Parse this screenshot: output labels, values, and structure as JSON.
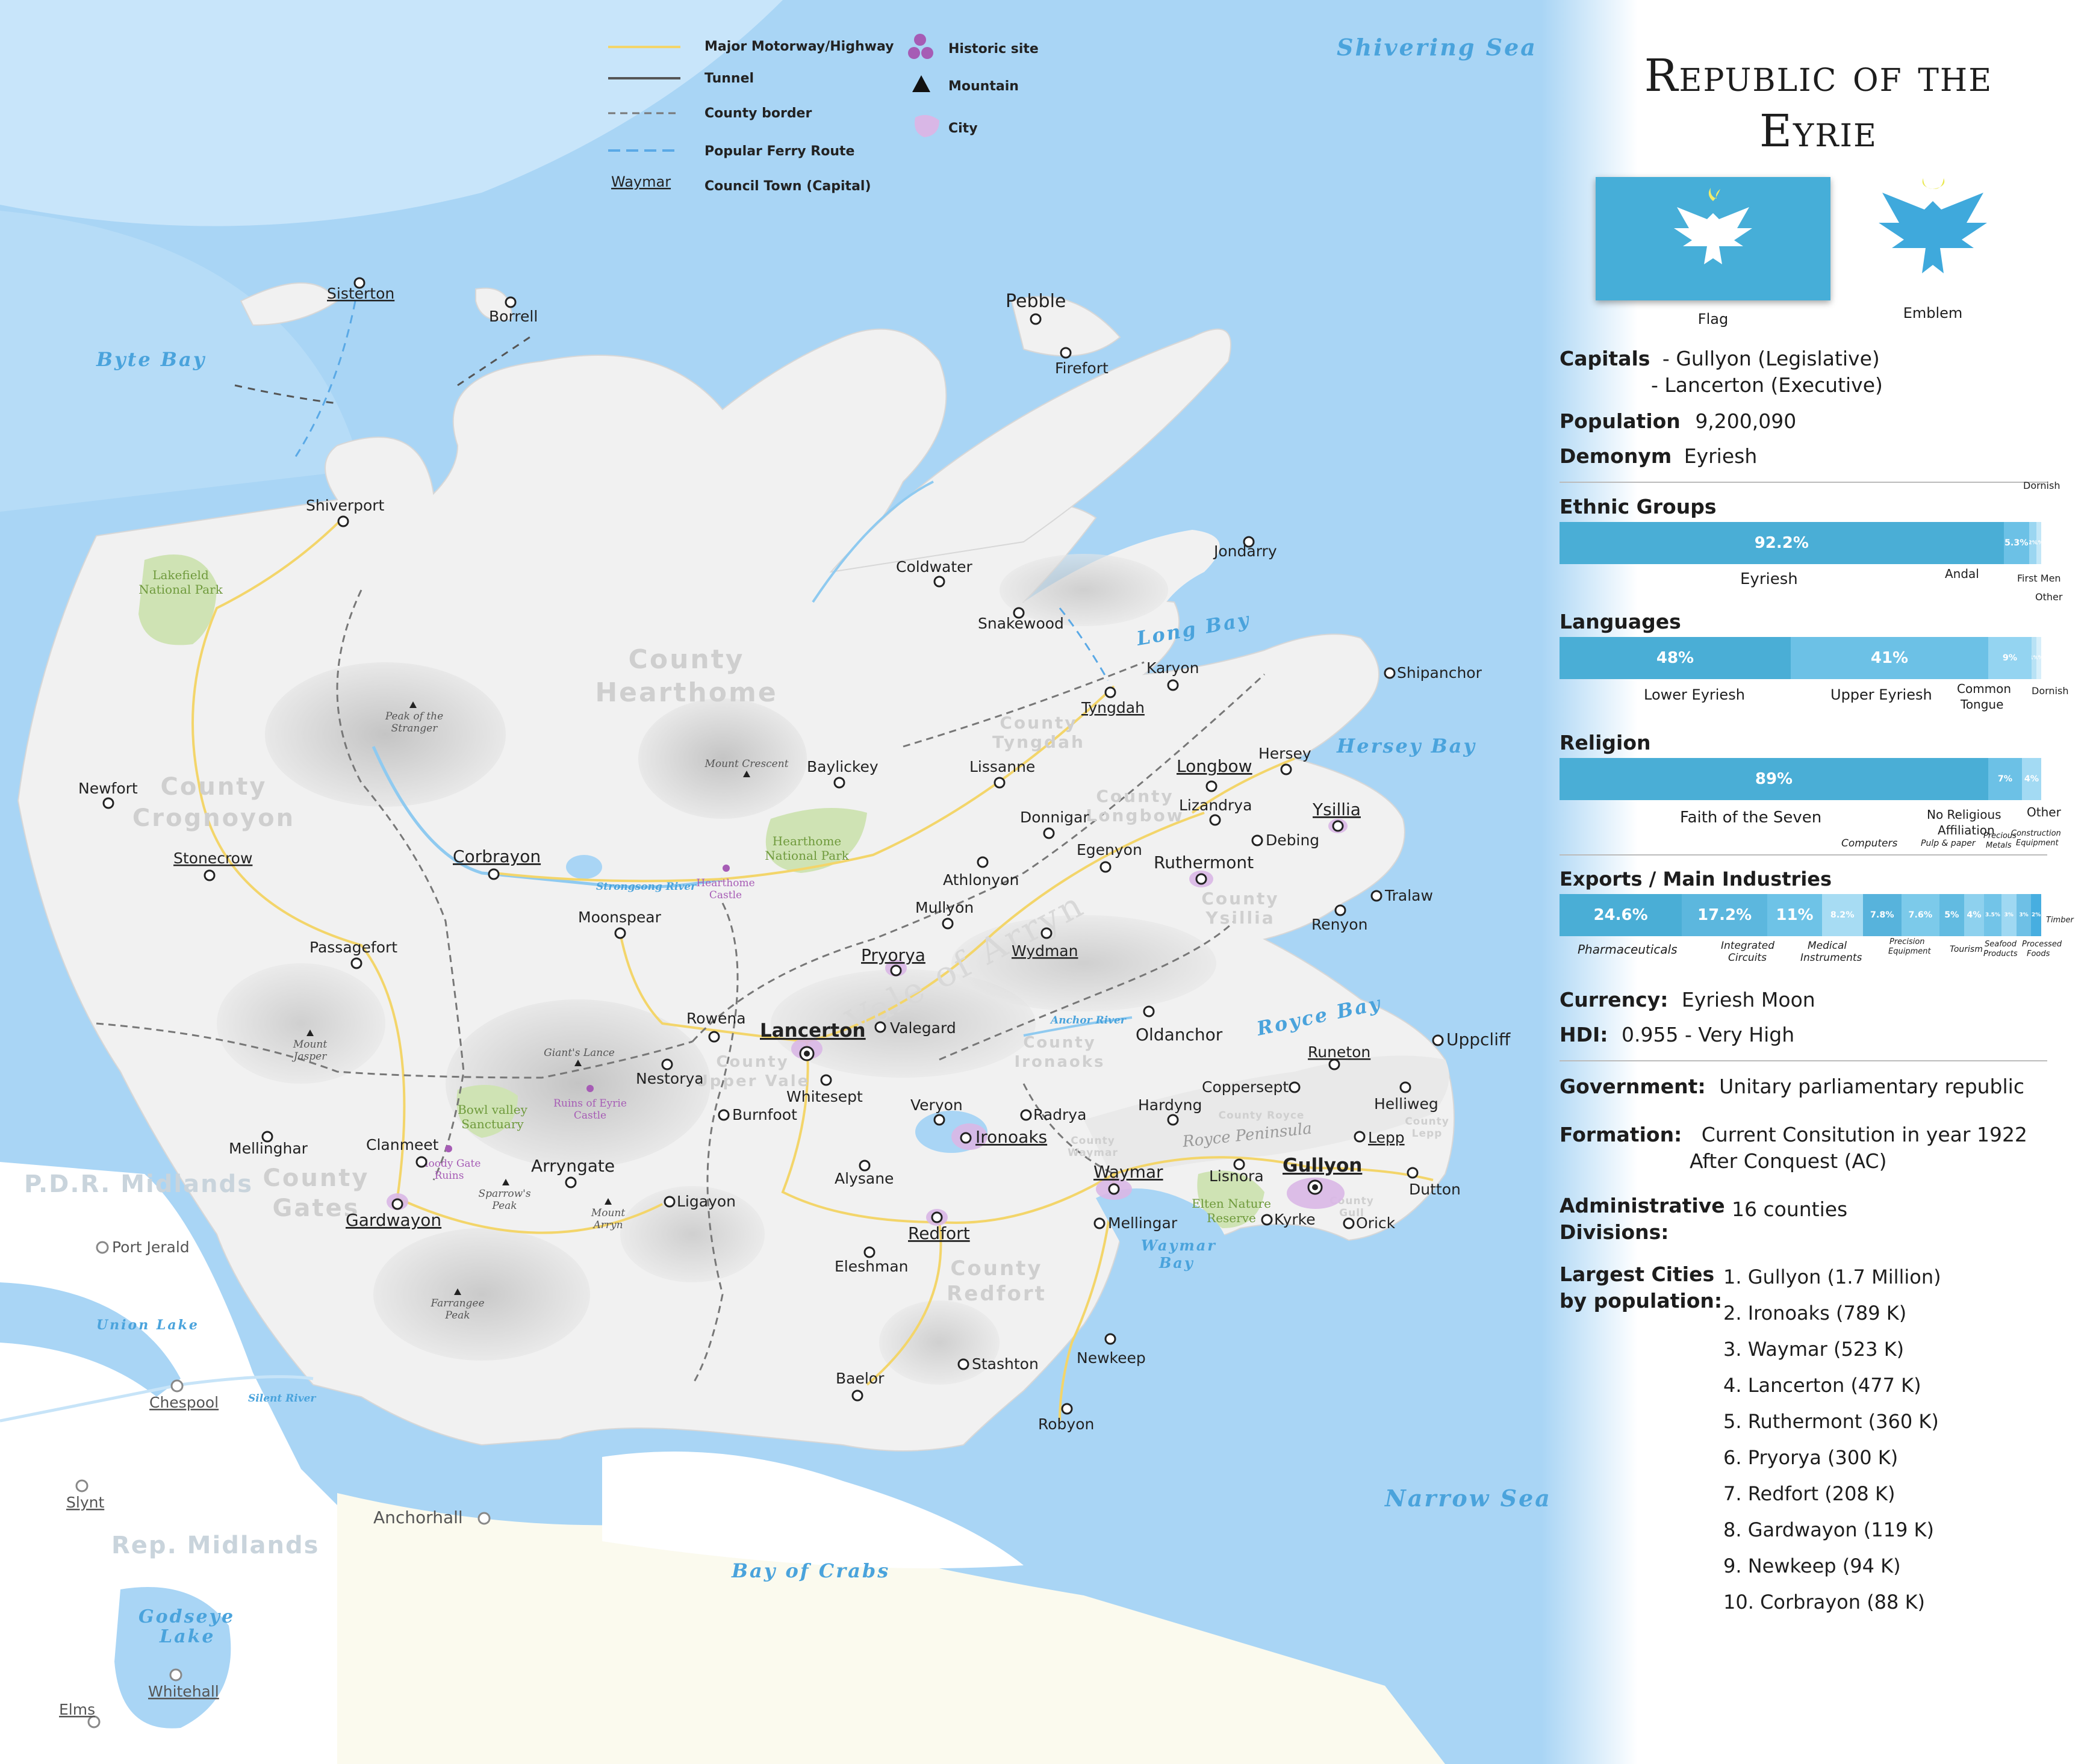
{
  "legend": {
    "highway": "Major Motorway/Highway",
    "tunnel": "Tunnel",
    "county_border": "County border",
    "ferry": "Popular Ferry Route",
    "capital_sample": "Waymar",
    "capital_desc": "Council Town (Capital)",
    "historic": "Historic site",
    "mountain": "Mountain",
    "city": "City"
  },
  "seas": {
    "shivering": "Shivering Sea",
    "byte": "Byte Bay",
    "long": "Long Bay",
    "hersey": "Hersey Bay",
    "royce": "Royce Bay",
    "narrow": "Narrow Sea",
    "crabs": "Bay of Crabs",
    "waymar_bay_1": "Waymar",
    "waymar_bay_2": "Bay",
    "union_lake": "Union Lake",
    "godseye_1": "Godseye",
    "godseye_2": "Lake",
    "strongsong": "Strongsong River",
    "silent": "Silent River",
    "anchor": "Anchor River"
  },
  "regions": {
    "pdr": "P.D.R. Midlands",
    "rep": "Rep. Midlands"
  },
  "counties": [
    {
      "l1": "County",
      "l2": "Hearthome"
    },
    {
      "l1": "County",
      "l2": "Crognoyon"
    },
    {
      "l1": "County",
      "l2": "Gates"
    },
    {
      "l1": "County",
      "l2": "Tyngdah"
    },
    {
      "l1": "County",
      "l2": "Longbow"
    },
    {
      "l1": "County",
      "l2": "Ysillia"
    },
    {
      "l1": "County",
      "l2": "Ironaoks"
    },
    {
      "l1": "County",
      "l2": "Upper Vale"
    },
    {
      "l1": "County",
      "l2": "Redfort"
    },
    {
      "l1": "County",
      "l2": "Waymar"
    },
    {
      "l1": "County Royce",
      "l2": ""
    },
    {
      "l1": "County",
      "l2": "Lepp"
    },
    {
      "l1": "County",
      "l2": "Gull"
    }
  ],
  "vale": "Vale of Arryn",
  "royce_peninsula": "Royce Peninsula",
  "parks": {
    "lakefield_1": "Lakefield",
    "lakefield_2": "National Park",
    "hearthome_1": "Hearthome",
    "hearthome_2": "National Park",
    "bowl_1": "Bowl valley",
    "bowl_2": "Sanctuary",
    "elten_1": "Elten Nature",
    "elten_2": "Reserve"
  },
  "historic_sites": {
    "hearthome_castle_1": "Hearthome",
    "hearthome_castle_2": "Castle",
    "eyrie_1": "Ruins of Eyrie",
    "eyrie_2": "Castle",
    "gate_1": "Bloody Gate",
    "gate_2": "Ruins"
  },
  "mountains": {
    "stranger_1": "Peak of the",
    "stranger_2": "Stranger",
    "crescent": "Mount Crescent",
    "jasper_1": "Mount",
    "jasper_2": "Jasper",
    "giants": "Giant's Lance",
    "sparrow_1": "Sparrow's",
    "sparrow_2": "Peak",
    "arryn_1": "Mount",
    "arryn_2": "Arryn",
    "farrangee_1": "Farrangee",
    "farrangee_2": "Peak"
  },
  "places": {
    "sisterton": "Sisterton",
    "borrell": "Borrell",
    "pebble": "Pebble",
    "firefort": "Firefort",
    "shiverport": "Shiverport",
    "coldwater": "Coldwater",
    "jondarry": "Jondarry",
    "snakewood": "Snakewood",
    "karyon": "Karyon",
    "shipanchor": "Shipanchor",
    "tyngdah": "Tyngdah",
    "newfort": "Newfort",
    "baylickey": "Baylickey",
    "lissanne": "Lissanne",
    "longbow": "Longbow",
    "hersey": "Hersey",
    "ysillia": "Ysillia",
    "stonecrow": "Stonecrow",
    "corbrayon": "Corbrayon",
    "donnigar": "Donnigar",
    "lizandrya": "Lizandrya",
    "debing": "Debing",
    "egenyon": "Egenyon",
    "ruthermont": "Ruthermont",
    "athlonyon": "Athlonyon",
    "tralaw": "Tralaw",
    "moonspear": "Moonspear",
    "mullyon": "Mullyon",
    "renyon": "Renyon",
    "passagefort": "Passagefort",
    "pryorya": "Pryorya",
    "wydman": "Wydman",
    "rowena": "Rowena",
    "lancerton": "Lancerton",
    "valegard": "Valegard",
    "oldanchor": "Oldanchor",
    "uppcliff": "Uppcliff",
    "nestorya": "Nestorya",
    "whitesept": "Whitesept",
    "runeton": "Runeton",
    "coppersept": "Coppersept",
    "helliweg": "Helliweg",
    "burnfoot": "Burnfoot",
    "veryon": "Veryon",
    "radrya": "Radrya",
    "hardyng": "Hardyng",
    "mellinghar": "Mellinghar",
    "clanmeet": "Clanmeet",
    "ironoaks": "Ironoaks",
    "lepp": "Lepp",
    "arryngate": "Arryngate",
    "alysane": "Alysane",
    "waymar": "Waymar",
    "lisnora": "Lisnora",
    "gullyon": "Gullyon",
    "dutton": "Dutton",
    "ligayon": "Ligayon",
    "gardwayon": "Gardwayon",
    "mellingar": "Mellingar",
    "kyrke": "Kyrke",
    "orick": "Orick",
    "redfort": "Redfort",
    "port_jerald": "Port Jerald",
    "eleshman": "Eleshman",
    "chespool": "Chespool",
    "stashton": "Stashton",
    "newkeep": "Newkeep",
    "baelor": "Baelor",
    "robyon": "Robyon",
    "slynt": "Slynt",
    "anchorhall": "Anchorhall",
    "whitehall": "Whitehall",
    "elms": "Elms"
  },
  "panel": {
    "title_1": "Republic of the",
    "title_2": "Eyrie",
    "flag_caption": "Flag",
    "emblem_caption": "Emblem",
    "capitals_label": "Capitals",
    "capital_1": "- Gullyon (Legislative)",
    "capital_2": "- Lancerton (Executive)",
    "population_label": "Population",
    "population": "9,200,090",
    "demonym_label": "Demonym",
    "demonym": "Eyriesh",
    "ethnic_title": "Ethnic Groups",
    "languages_title": "Languages",
    "religion_title": "Religion",
    "exports_title": "Exports / Main Industries",
    "currency_label": "Currency:",
    "currency": "Eyriesh Moon",
    "hdi_label": "HDI:",
    "hdi": "0.955 - Very High",
    "government_label": "Government:",
    "government": "Unitary parliamentary republic",
    "formation_label": "Formation:",
    "formation_1": "Current Consitution in year 1922",
    "formation_2": "After Conquest (AC)",
    "admin_label_1": "Administrative",
    "admin_label_2": "Divisions:",
    "admin": "16 counties",
    "largest_label_1": "Largest Cities",
    "largest_label_2": "by population:",
    "largest": [
      "1. Gullyon (1.7 Million)",
      "2. Ironoaks (789 K)",
      "3. Waymar (523 K)",
      "4. Lancerton (477 K)",
      "5. Ruthermont (360 K)",
      "6. Pryorya (300 K)",
      "7. Redfort (208 K)",
      "8. Gardwayon (119 K)",
      "9. Newkeep (94 K)",
      "10. Corbrayon (88 K)"
    ]
  },
  "ethnic": [
    {
      "name": "Eyriesh",
      "value": 92.2,
      "label": "92.2%",
      "color": "#4aaed6"
    },
    {
      "name": "Andal",
      "value": 5.3,
      "label": "5.3%",
      "color": "#6cc1e6"
    },
    {
      "name": "Dornish",
      "value": 1.5,
      "label": "2%",
      "color": "#9bd6f1"
    },
    {
      "name": "First Men",
      "value": 1.0,
      "label": "1%",
      "color": "#c3e7f7"
    }
  ],
  "languages": [
    {
      "name": "Lower Eyriesh",
      "value": 48,
      "label": "48%",
      "color": "#4aaed6"
    },
    {
      "name": "Upper Eyriesh",
      "value": 41,
      "label": "41%",
      "color": "#6cc1e6"
    },
    {
      "name_1": "Common",
      "name_2": "Tongue",
      "value": 9,
      "label": "9%",
      "color": "#94d4f1"
    },
    {
      "name": "Other",
      "value": 1,
      "label": "1%",
      "color": "#b8e2f5"
    },
    {
      "name": "Dornish",
      "value": 1,
      "label": "1%",
      "color": "#d7effa"
    }
  ],
  "religion": [
    {
      "name": "Faith of the Seven",
      "value": 89,
      "label": "89%",
      "color": "#4aaed6"
    },
    {
      "name_1": "No Religious",
      "name_2": "Affiliation",
      "value": 7,
      "label": "7%",
      "color": "#6cc1e6"
    },
    {
      "name": "Other",
      "value": 4,
      "label": "4%",
      "color": "#a3daf3"
    }
  ],
  "exports": [
    {
      "name": "Pharmaceuticals",
      "value": 24.6,
      "label": "24.6%",
      "color": "#4aaed6"
    },
    {
      "name_1": "Integrated",
      "name_2": "Circuits",
      "value": 17.2,
      "label": "17.2%",
      "color": "#5cb7de"
    },
    {
      "name_1": "Medical",
      "name_2": "Instruments",
      "value": 11,
      "label": "11%",
      "color": "#6ec3e7"
    },
    {
      "name": "Computers",
      "value": 8.2,
      "label": "8.2%",
      "color": "#a7dcf3"
    },
    {
      "name_1": "Precision",
      "name_2": "Equipment",
      "value": 7.8,
      "label": "7.8%",
      "color": "#57b3dc"
    },
    {
      "name": "Pulp & paper",
      "value": 7.6,
      "label": "7.6%",
      "color": "#7ccaea"
    },
    {
      "name": "Tourism",
      "value": 5,
      "label": "5%",
      "color": "#62bbe1"
    },
    {
      "name_1": "Precious",
      "name_2": "Metals",
      "value": 4,
      "label": "4%",
      "color": "#8ed1ee"
    },
    {
      "name_1": "Seafood",
      "name_2": "Products",
      "value": 3.5,
      "label": "3.5%",
      "color": "#72c4e8"
    },
    {
      "name_1": "Construction",
      "name_2": "Equipment",
      "value": 3,
      "label": "3%",
      "color": "#9fd8f2"
    },
    {
      "name_1": "Processed",
      "name_2": "Foods",
      "value": 3,
      "label": "3%",
      "color": "#6ec0e6"
    },
    {
      "name": "Timber",
      "value": 2,
      "label": "2%",
      "color": "#47aee0"
    }
  ],
  "colors": {
    "sea": "#a9d5f5",
    "land": "#f1f1f1",
    "neighbor": "#ffffff",
    "park": "#cfe3b4",
    "road": "#f3d56a",
    "accent": "#4aaed6"
  }
}
